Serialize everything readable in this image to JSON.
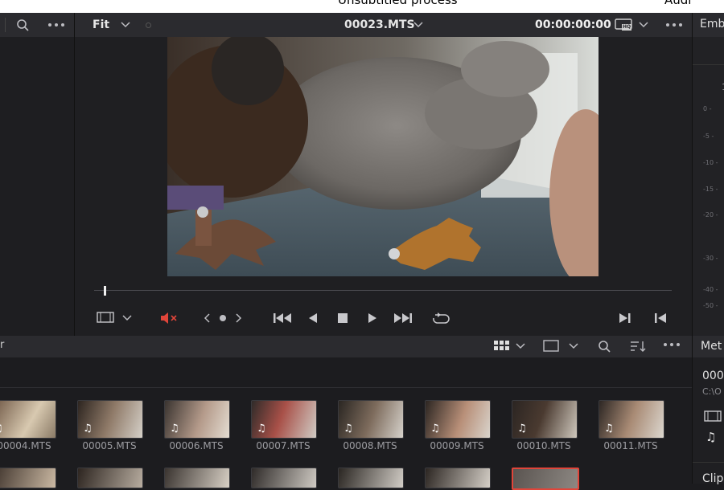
{
  "window": {
    "top_label": "Unsubtitled process",
    "top_right_label": "Audi"
  },
  "media_pool": {
    "panel_label": ""
  },
  "viewer": {
    "zoom_label": "Fit",
    "clip_name": "00023.MTS",
    "timecode": "00:00:00:00",
    "hq_badge": "HQ"
  },
  "right_panel": {
    "title": "Emb",
    "meter_top": "1",
    "scale": [
      "0 -",
      "-5 -",
      "-10 -",
      "-15 -",
      "-20 -",
      "-30 -",
      "-40 -",
      "-50 -"
    ]
  },
  "bin": {
    "left_label": "r"
  },
  "metadata": {
    "title": "Met",
    "clip_prefix": "000",
    "path_prefix": "C:\\O",
    "clip_label": "Clip"
  },
  "clips_row1": [
    "00004.MTS",
    "00005.MTS",
    "00006.MTS",
    "00007.MTS",
    "00008.MTS",
    "00009.MTS",
    "00010.MTS",
    "00011.MTS"
  ],
  "colors": {
    "accent_red": "#e0453a",
    "panel_bg": "#1c1c1f",
    "header_bg": "#2b2b2f",
    "selected_border": "#e0453a"
  },
  "icons": [
    "search-icon",
    "more-icon",
    "chevron-down-icon",
    "film-icon",
    "speaker-mute-icon",
    "nav-prev-next-icon",
    "jump-start-icon",
    "step-back-icon",
    "stop-icon",
    "play-icon",
    "jump-end-icon",
    "loop-icon",
    "mark-out-icon",
    "mark-in-icon",
    "grid-view-icon",
    "layout-icon",
    "sort-icon",
    "music-note-icon"
  ]
}
